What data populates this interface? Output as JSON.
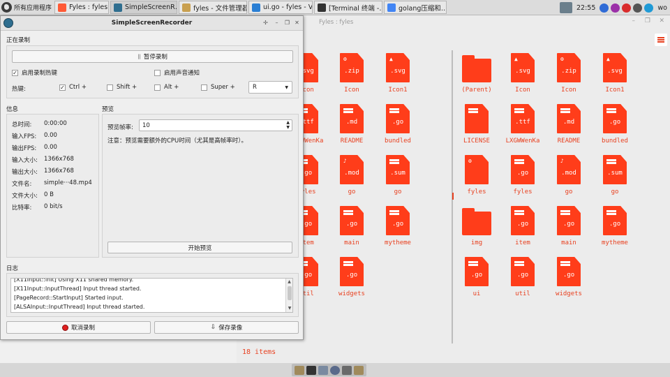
{
  "taskbar": {
    "start_label": "所有应用程序",
    "tasks": [
      {
        "label": "Fyles : fyles",
        "color": "#ff5a36"
      },
      {
        "label": "SimpleScreenR…",
        "color": "#2f6e8f"
      },
      {
        "label": "fyles - 文件管理器",
        "color": "#c9a050"
      },
      {
        "label": "ui.go - fyles - V…",
        "color": "#2a7fd4"
      },
      {
        "label": "[Terminal 终端 -…",
        "color": "#333333"
      },
      {
        "label": "golang压缩和…",
        "color": "#4285f4"
      }
    ],
    "clock": "22:55",
    "user": "wo"
  },
  "fyles": {
    "title": "Fyles : fyles",
    "left_files": [
      {
        "label": "Icon",
        "ext": ".svg",
        "kind": "image"
      },
      {
        "label": "Icon",
        "ext": ".zip",
        "kind": "archive"
      },
      {
        "label": "Icon1",
        "ext": ".svg",
        "kind": "image"
      },
      {
        "label": "LXGWWenKa",
        "ext": ".ttf",
        "kind": "doc"
      },
      {
        "label": "README",
        "ext": ".md",
        "kind": "doc"
      },
      {
        "label": "bundled",
        "ext": ".go",
        "kind": "doc"
      },
      {
        "label": "fyles",
        "ext": ".go",
        "kind": "doc"
      },
      {
        "label": "go",
        "ext": ".mod",
        "kind": "music"
      },
      {
        "label": "go",
        "ext": ".sum",
        "kind": "doc"
      },
      {
        "label": "item",
        "ext": ".go",
        "kind": "doc"
      },
      {
        "label": "main",
        "ext": ".go",
        "kind": "doc"
      },
      {
        "label": "mytheme",
        "ext": ".go",
        "kind": "doc"
      },
      {
        "label": "util",
        "ext": ".go",
        "kind": "doc"
      },
      {
        "label": "widgets",
        "ext": ".go",
        "kind": "doc"
      }
    ],
    "right_files": [
      {
        "label": "(Parent)",
        "ext": "",
        "kind": "folder"
      },
      {
        "label": "Icon",
        "ext": ".svg",
        "kind": "image"
      },
      {
        "label": "Icon",
        "ext": ".zip",
        "kind": "archive"
      },
      {
        "label": "Icon1",
        "ext": ".svg",
        "kind": "image"
      },
      {
        "label": "LICENSE",
        "ext": "",
        "kind": "doc"
      },
      {
        "label": "LXGWWenKa",
        "ext": ".ttf",
        "kind": "doc"
      },
      {
        "label": "README",
        "ext": ".md",
        "kind": "doc"
      },
      {
        "label": "bundled",
        "ext": ".go",
        "kind": "doc"
      },
      {
        "label": "fyles",
        "ext": "",
        "kind": "gear"
      },
      {
        "label": "fyles",
        "ext": ".go",
        "kind": "doc"
      },
      {
        "label": "go",
        "ext": ".mod",
        "kind": "music"
      },
      {
        "label": "go",
        "ext": ".sum",
        "kind": "doc"
      },
      {
        "label": "img",
        "ext": "",
        "kind": "folder"
      },
      {
        "label": "item",
        "ext": ".go",
        "kind": "doc"
      },
      {
        "label": "main",
        "ext": ".go",
        "kind": "doc"
      },
      {
        "label": "mytheme",
        "ext": ".go",
        "kind": "doc"
      },
      {
        "label": "ui",
        "ext": ".go",
        "kind": "doc"
      },
      {
        "label": "util",
        "ext": ".go",
        "kind": "doc"
      },
      {
        "label": "widgets",
        "ext": ".go",
        "kind": "doc"
      }
    ],
    "items_count": "18 items"
  },
  "ssr": {
    "title": "SimpleScreenRecorder",
    "section_recording": "正在录制",
    "pause_button": "暂停录制",
    "pause_icon": "||",
    "enable_hotkey": "启用录制热键",
    "enable_sound": "启用声音通知",
    "hotkey_label": "热键:",
    "ctrl": "Ctrl +",
    "shift": "Shift +",
    "alt": "Alt +",
    "super": "Super +",
    "key_value": "R",
    "section_info": "信息",
    "section_preview": "预览",
    "info": [
      {
        "label": "总时间:",
        "value": "0:00:00"
      },
      {
        "label": "输入FPS:",
        "value": "0.00"
      },
      {
        "label": "输出FPS:",
        "value": "0.00"
      },
      {
        "label": "输入大小:",
        "value": "1366x768"
      },
      {
        "label": "输出大小:",
        "value": "1366x768"
      },
      {
        "label": "文件名:",
        "value": "simple···48.mp4"
      },
      {
        "label": "文件大小:",
        "value": "0 B"
      },
      {
        "label": "比特率:",
        "value": "0 bit/s"
      }
    ],
    "preview_rate_label": "预览帧率:",
    "preview_rate_value": "10",
    "preview_note": "注意：预览需要额外的CPU时间（尤其是高帧率时）。",
    "start_preview": "开始预览",
    "section_log": "日志",
    "log_lines": [
      "[X11Input::Init] Using X11 shared memory.",
      "[X11Input::InputThread] Input thread started.",
      "[PageRecord::StartInput] Started input.",
      "[ALSAInput::InputThread] Input thread started."
    ],
    "cancel_button": "取消录制",
    "save_button": "保存录像"
  }
}
